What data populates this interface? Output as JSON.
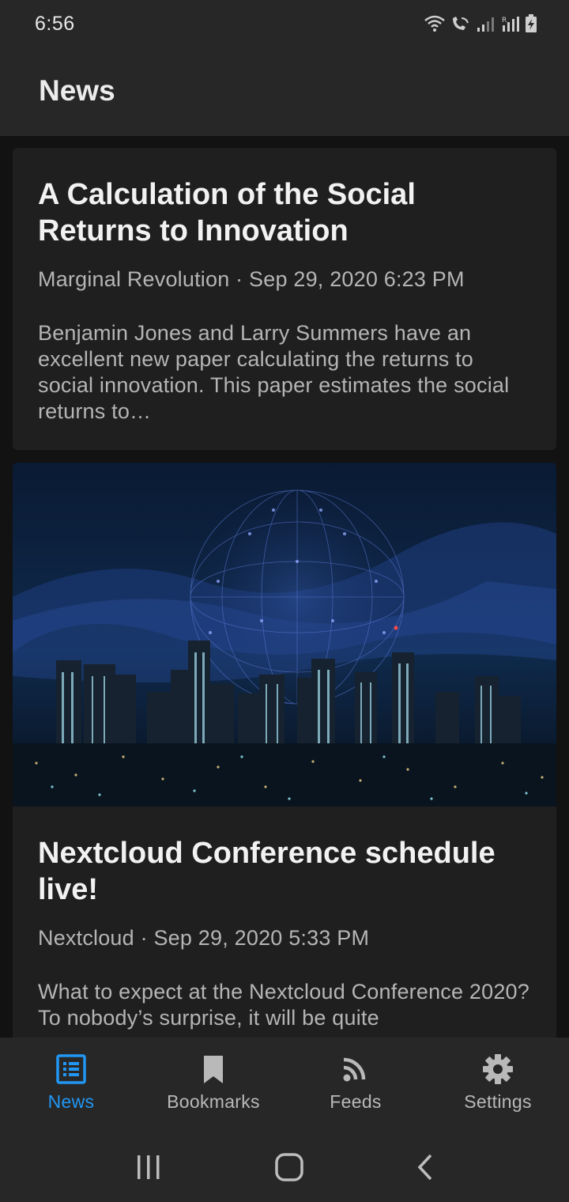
{
  "status_bar": {
    "time": "6:56"
  },
  "app_bar": {
    "title": "News"
  },
  "articles": [
    {
      "title": "A Calculation of the Social Returns to Innovation",
      "meta": "Marginal Revolution · Sep 29, 2020 6:23 PM",
      "summary": "Benjamin Jones and Larry Summers have an excellent new paper calculating the returns to social innovation. This paper estimates the social returns to…"
    },
    {
      "title": "Nextcloud Conference schedule live!",
      "meta": "Nextcloud · Sep 29, 2020 5:33 PM",
      "summary": "What to expect at the Nextcloud Conference 2020? To nobody’s surprise, it will be quite"
    }
  ],
  "bottom_nav": [
    {
      "label": "News",
      "icon": "article-list-icon",
      "active": true
    },
    {
      "label": "Bookmarks",
      "icon": "bookmark-icon",
      "active": false
    },
    {
      "label": "Feeds",
      "icon": "rss-feed-icon",
      "active": false
    },
    {
      "label": "Settings",
      "icon": "gear-icon",
      "active": false
    }
  ],
  "colors": {
    "accent": "#2196f3",
    "background": "#121212",
    "surface": "#272727",
    "card": "#1f1f1f"
  }
}
